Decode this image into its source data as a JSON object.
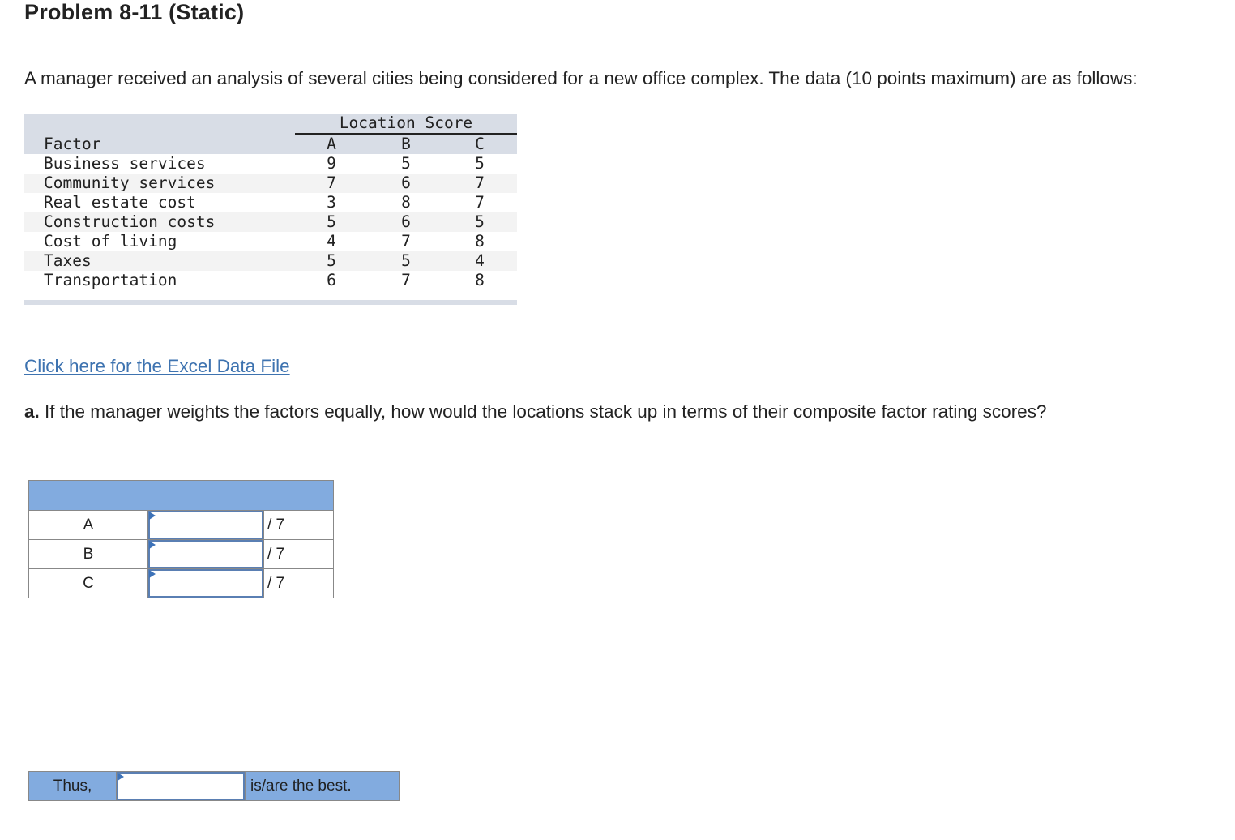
{
  "title": "Problem 8-11 (Static)",
  "intro": "A manager received an analysis of several cities being considered for a new office complex. The data (10 points maximum) are as follows:",
  "data_table": {
    "group_header": "Location Score",
    "columns": [
      "Factor",
      "A",
      "B",
      "C"
    ],
    "rows": [
      {
        "factor": "Business services",
        "a": "9",
        "b": "5",
        "c": "5"
      },
      {
        "factor": "Community services",
        "a": "7",
        "b": "6",
        "c": "7"
      },
      {
        "factor": "Real estate cost",
        "a": "3",
        "b": "8",
        "c": "7"
      },
      {
        "factor": "Construction costs",
        "a": "5",
        "b": "6",
        "c": "5"
      },
      {
        "factor": "Cost of living",
        "a": "4",
        "b": "7",
        "c": "8"
      },
      {
        "factor": "Taxes",
        "a": "5",
        "b": "5",
        "c": "4"
      },
      {
        "factor": "Transportation",
        "a": "6",
        "b": "7",
        "c": "8"
      }
    ]
  },
  "excel_link": "Click here for the Excel Data File",
  "question": {
    "label": "a.",
    "text": " If the manager weights the factors equally, how would the locations stack up in terms of their composite factor rating scores?"
  },
  "answer_table": {
    "rows": [
      {
        "label": "A",
        "value": "",
        "unit": "/ 7"
      },
      {
        "label": "B",
        "value": "",
        "unit": "/ 7"
      },
      {
        "label": "C",
        "value": "",
        "unit": "/ 7"
      }
    ]
  },
  "conclusion": {
    "prefix": "Thus,",
    "value": "",
    "suffix": "is/are the best."
  }
}
